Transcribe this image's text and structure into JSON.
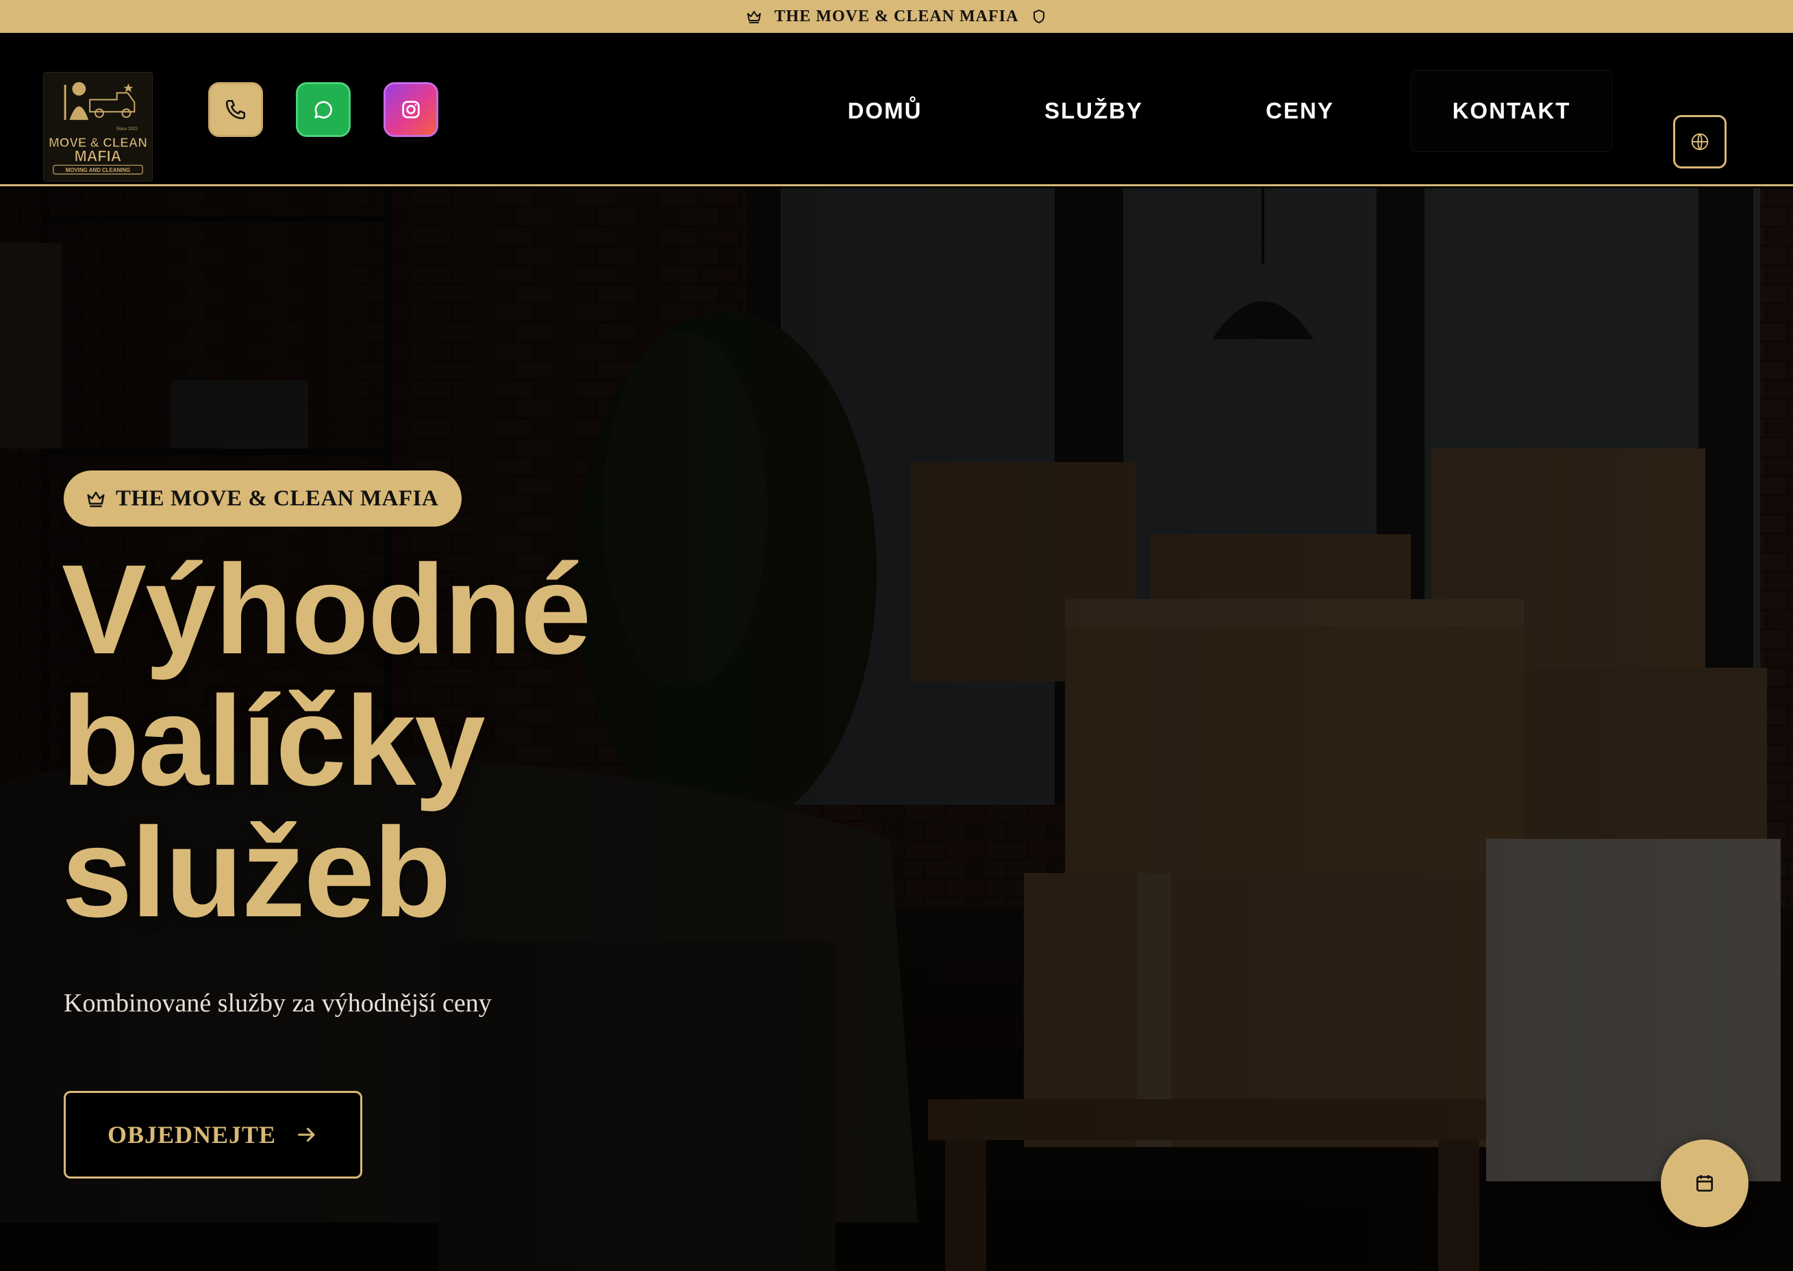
{
  "top_banner": {
    "text": "THE MOVE & CLEAN MAFIA",
    "left_icon": "crown-icon",
    "right_icon": "shield-icon"
  },
  "header": {
    "logo": {
      "line1": "MOVE & CLEAN",
      "line2": "MAFIA",
      "tagline": "MOVING AND CLEANING",
      "since": "Since 2025"
    },
    "social": [
      {
        "name": "phone",
        "icon": "phone-icon"
      },
      {
        "name": "whatsapp",
        "icon": "whatsapp-icon"
      },
      {
        "name": "instagram",
        "icon": "instagram-icon"
      }
    ],
    "nav": [
      {
        "label": "DOMŮ"
      },
      {
        "label": "SLUŽBY"
      },
      {
        "label": "CENY"
      },
      {
        "label": "KONTAKT"
      }
    ],
    "language_icon": "globe-icon"
  },
  "hero": {
    "badge": "THE MOVE & CLEAN MAFIA",
    "badge_icon": "crown-icon",
    "title_lines": [
      "Výhodné",
      "balíčky",
      "služeb"
    ],
    "subtitle": "Kombinované služby za výhodnější ceny",
    "cta_label": "OBJEDNEJTE",
    "cta_icon": "arrow-right-icon",
    "fab_icon": "calendar-icon"
  },
  "colors": {
    "accent_gold": "#d9b978",
    "background": "#000000",
    "whatsapp_green": "#22b150",
    "instagram_gradient": [
      "#9b3ee3",
      "#e33d8f",
      "#f5603d"
    ]
  }
}
